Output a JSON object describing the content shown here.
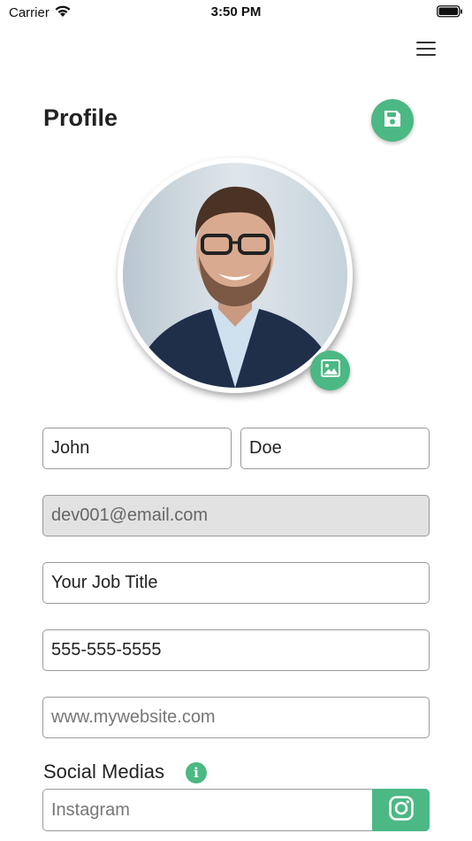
{
  "status_bar": {
    "carrier": "Carrier",
    "time": "3:50 PM"
  },
  "header": {
    "title": "Profile"
  },
  "form": {
    "first_name": "John",
    "last_name": "Doe",
    "email": "dev001@email.com",
    "job_title": "Your Job Title",
    "phone": "555-555-5555",
    "website_placeholder": "www.mywebsite.com"
  },
  "social": {
    "label": "Social Medias",
    "info_glyph": "i",
    "instagram_placeholder": "Instagram"
  },
  "icons": {
    "menu": "hamburger-icon",
    "save": "floppy-disk-icon",
    "change_photo": "image-icon",
    "info": "info-icon",
    "instagram": "instagram-icon"
  },
  "colors": {
    "accent": "#4cb884",
    "disabled_field": "#e2e2e2",
    "field_border": "#9a9a9a"
  }
}
